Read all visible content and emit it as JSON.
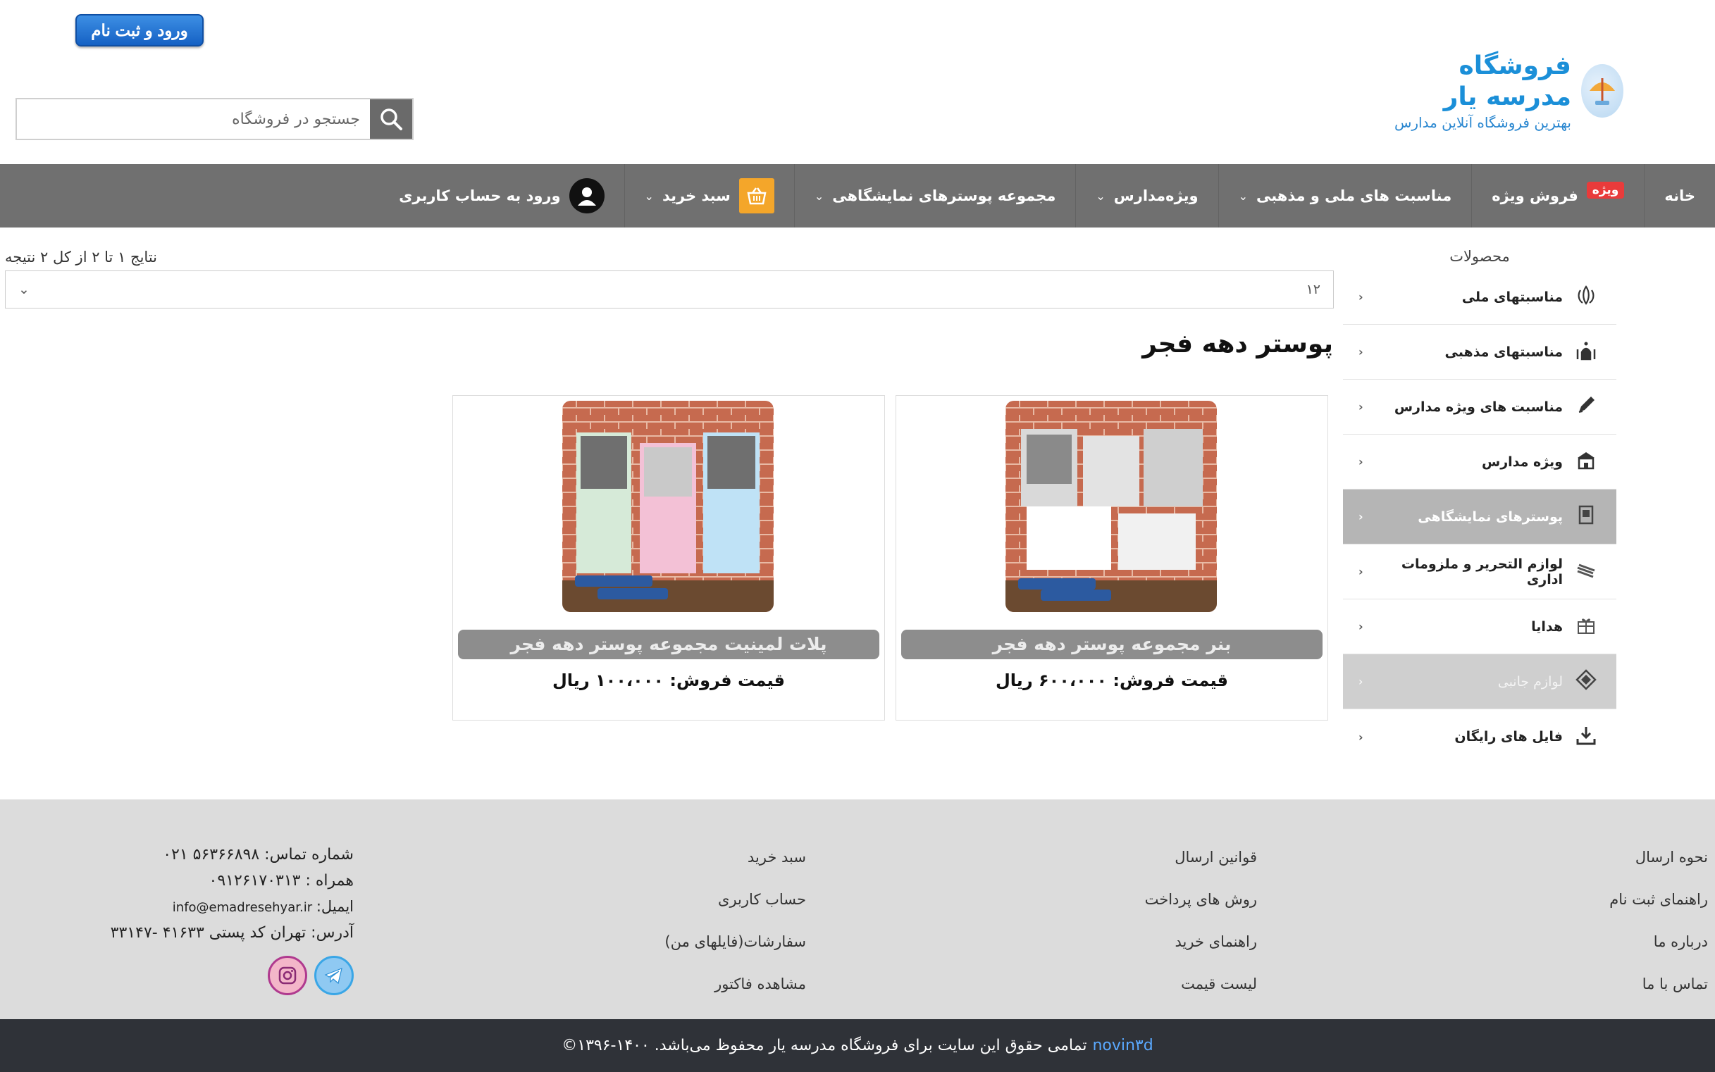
{
  "header": {
    "login_button": "ورود و ثبت نام",
    "search_placeholder": "جستجو در فروشگاه",
    "logo_title": "فروشگاه مدرسه یار",
    "logo_subtitle": "بهترین فروشگاه آنلاین مدارس"
  },
  "nav": {
    "home": "خانه",
    "special_badge": "ویژه",
    "special_sale": "فروش ویژه",
    "occasions": "مناسبت های ملی و مذهبی",
    "schools": "ویژه‌مدارس",
    "posters": "مجموعه پوسترهای نمایشگاهی",
    "cart": "سبد خرید",
    "account": "ورود به حساب کاربری"
  },
  "sidebar": {
    "title": "محصولات",
    "items": [
      {
        "label": "مناسبتهای ملی",
        "icon": "emblem-icon"
      },
      {
        "label": "مناسبتهای مذهبی",
        "icon": "mosque-icon"
      },
      {
        "label": "مناسبت های ویژه مدارس",
        "icon": "pencil-icon"
      },
      {
        "label": "ویژه مدارس",
        "icon": "school-icon"
      },
      {
        "label": "پوسترهای نمایشگاهی",
        "icon": "poster-icon"
      },
      {
        "label": "لوازم التحریر و ملزومات اداری",
        "icon": "stationery-icon"
      },
      {
        "label": "هدایا",
        "icon": "gift-icon"
      },
      {
        "label": "لوازم جانبی",
        "icon": "accessory-icon"
      },
      {
        "label": "فایل های رایگان",
        "icon": "download-icon"
      }
    ]
  },
  "main": {
    "result_count": "نتایج ۱ تا ۲ از کل ۲ نتیجه",
    "per_page": "۱۲",
    "page_title": "پوستر دهه فجر",
    "products": [
      {
        "name": "بنر مجموعه پوستر دهه فجر",
        "price": "قیمت فروش: ۶۰۰،۰۰۰ ریال"
      },
      {
        "name": "پلات لمینیت مجموعه پوستر دهه فجر",
        "price": "قیمت فروش: ۱۰۰،۰۰۰ ریال"
      }
    ]
  },
  "footer": {
    "col1": [
      "نحوه ارسال",
      "راهنمای ثبت نام",
      "درباره ما",
      "تماس با ما"
    ],
    "col2": [
      "قوانین ارسال",
      "روش های پرداخت",
      "راهنمای خرید",
      "لیست قیمت"
    ],
    "col3": [
      "سبد خرید",
      "حساب کاربری",
      "سفارشات(فایلهای من)",
      "مشاهده فاکتور"
    ],
    "phone": "شماره تماس: ۵۶۳۶۶۸۹۸  ۰۲۱",
    "mobile": "همراه : ۰۹۱۲۶۱۷۰۳۱۳",
    "email_label": "ایمیل:",
    "email": "info@emadresehyar.ir",
    "address": "آدرس: تهران کد پستی ۴۱۶۳۳ -۳۳۱۴۷"
  },
  "copyright": {
    "brand": "novin۳d",
    "text": "تمامی حقوق این سایت برای فروشگاه مدرسه یار محفوظ می‌باشد. ۱۴۰۰-۱۳۹۶©"
  },
  "colors": {
    "nav_bg": "#707070",
    "accent_blue": "#1b8fd8",
    "cart_orange": "#f4a62a",
    "footer_bg": "#dcdcdc",
    "copyright_bg": "#2f3238"
  }
}
